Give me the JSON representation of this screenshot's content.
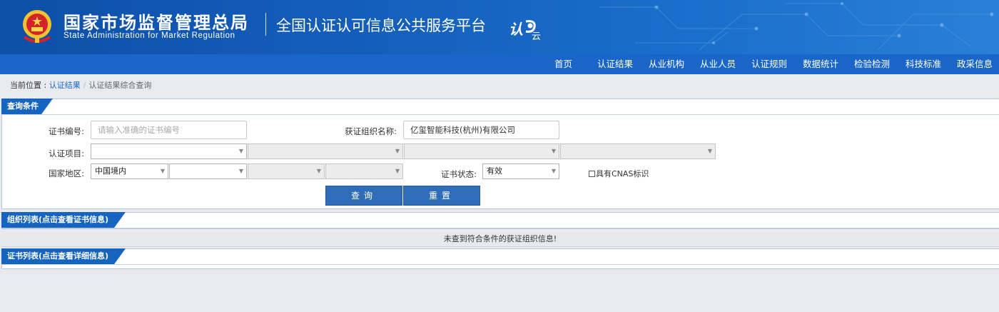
{
  "header": {
    "title_cn": "国家市场监督管理总局",
    "title_en": "State Administration  for  Market Regulation",
    "platform": "全国认证认可信息公共服务平台",
    "logo_text_1": "认",
    "logo_text_2": "云"
  },
  "nav": {
    "items": [
      "首页",
      "认证结果",
      "从业机构",
      "从业人员",
      "认证规则",
      "数据统计",
      "检验检测",
      "科技标准",
      "政采信息"
    ]
  },
  "breadcrumb": {
    "label": "当前位置 : ",
    "link": "认证结果",
    "separator": "/",
    "current": "认证结果综合查询"
  },
  "query": {
    "title": "查询条件",
    "cert_no_label": "证书编号:",
    "cert_no_placeholder": "请输入准确的证书编号",
    "org_label": "获证组织名称:",
    "org_value": "亿玺智能科技(杭州)有限公司",
    "project_label": "认证项目:",
    "region_label": "国家地区:",
    "region_value": "中国境内",
    "status_label": "证书状态:",
    "status_value": "有效",
    "cnas_label": "具有CNAS标识",
    "search_button": "查询",
    "reset_button": "重置"
  },
  "org_list": {
    "title": "组织列表(点击查看证书信息)",
    "empty_message": "未查到符合条件的获证组织信息!"
  },
  "cert_list": {
    "title": "证书列表(点击查看详细信息)"
  }
}
